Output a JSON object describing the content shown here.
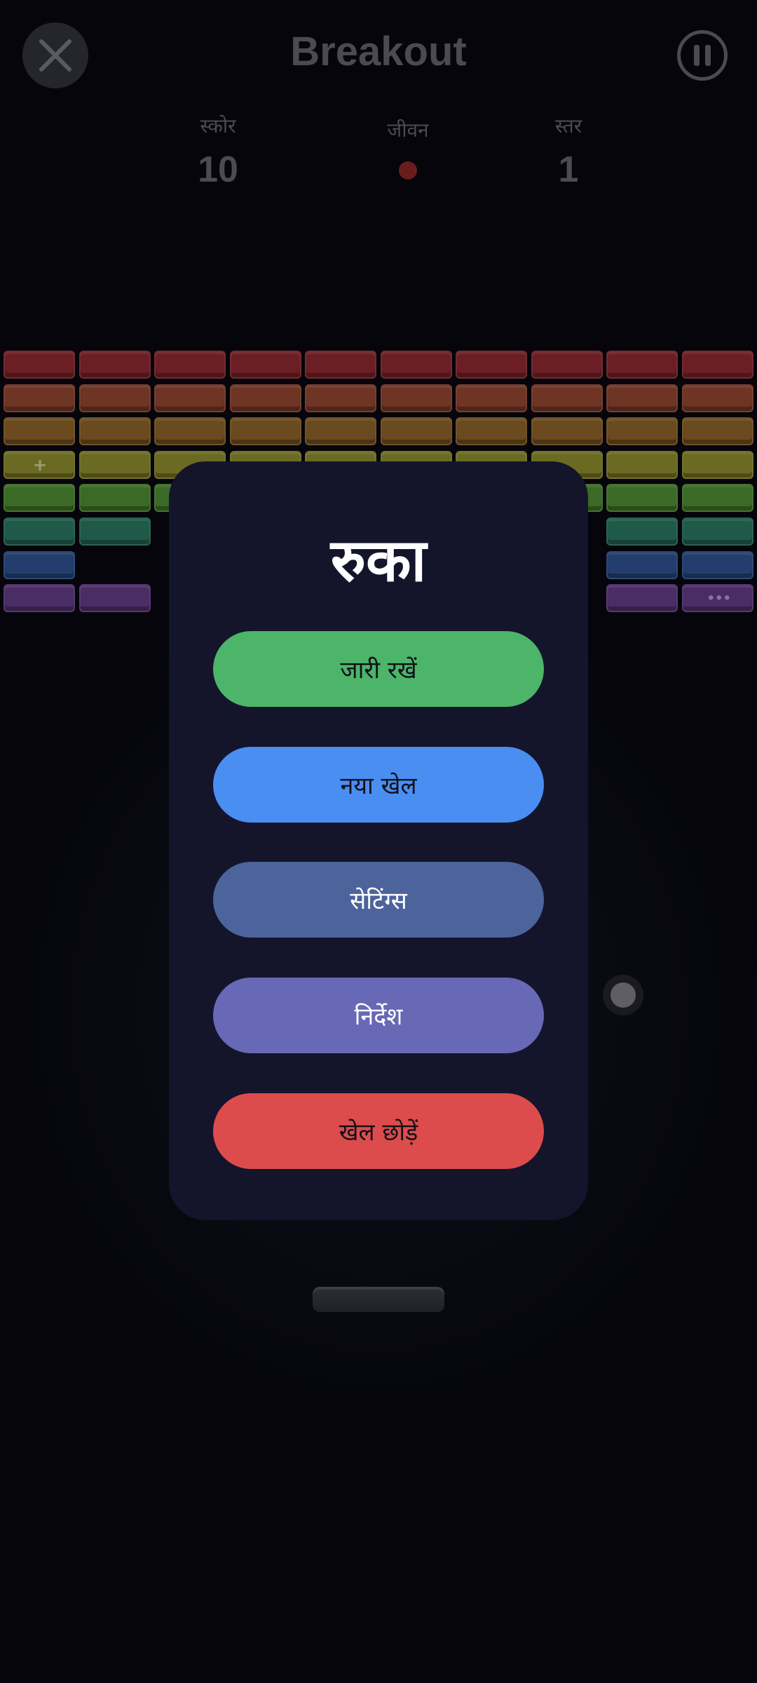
{
  "header": {
    "title": "Breakout",
    "close_icon": "close-icon",
    "pause_icon": "pause-icon"
  },
  "stats": {
    "score": {
      "label": "स्कोर",
      "value": "10"
    },
    "lives": {
      "label": "जीवन",
      "count": 1
    },
    "level": {
      "label": "स्तर",
      "value": "1"
    }
  },
  "bricks": {
    "row_colors": [
      "#6b1f24",
      "#6e3424",
      "#6a4a1e",
      "#6b6a22",
      "#3b6a26",
      "#1f5a48",
      "#233e6c",
      "#4b2d66"
    ],
    "cleared": [
      [
        5,
        2
      ],
      [
        5,
        3
      ],
      [
        5,
        4
      ],
      [
        5,
        5
      ],
      [
        5,
        6
      ],
      [
        5,
        7
      ],
      [
        6,
        1
      ],
      [
        6,
        2
      ],
      [
        6,
        3
      ],
      [
        6,
        4
      ],
      [
        6,
        5
      ],
      [
        6,
        6
      ],
      [
        6,
        7
      ],
      [
        7,
        2
      ],
      [
        7,
        3
      ],
      [
        7,
        4
      ],
      [
        7,
        5
      ],
      [
        7,
        6
      ],
      [
        7,
        7
      ]
    ],
    "markers": [
      {
        "row": 3,
        "col": 0,
        "symbol": "+"
      },
      {
        "row": 7,
        "col": 9,
        "symbol": "•••"
      }
    ]
  },
  "pause_menu": {
    "title": "रुका",
    "buttons": [
      {
        "id": "resume",
        "label": "जारी रखें",
        "color": "#4cb56a",
        "text_color": "#111118"
      },
      {
        "id": "new-game",
        "label": "नया खेल",
        "color": "#4a8ef2",
        "text_color": "#111118"
      },
      {
        "id": "settings",
        "label": "सेटिंग्स",
        "color": "#4c649b",
        "text_color": "#ffffff"
      },
      {
        "id": "instructions",
        "label": "निर्देश",
        "color": "#6768b6",
        "text_color": "#ffffff"
      },
      {
        "id": "quit",
        "label": "खेल छोड़ें",
        "color": "#dc4c4c",
        "text_color": "#111118"
      }
    ]
  },
  "colors": {
    "modal_bg": "#14152b",
    "background": "#05050c"
  }
}
